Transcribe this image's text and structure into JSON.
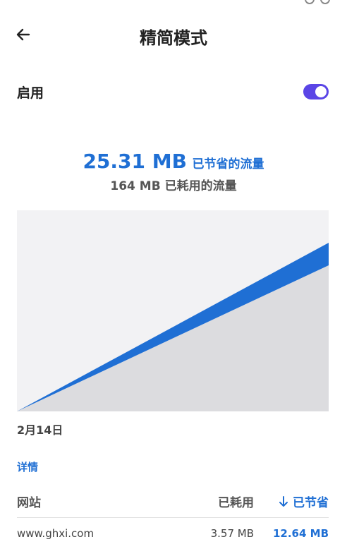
{
  "header": {
    "title": "精简模式",
    "back_icon": "arrow-left-icon"
  },
  "settings": {
    "enable_label": "启用",
    "enabled": true,
    "toggle_color": "#5a45e6"
  },
  "stats": {
    "saved_value": "25.31 MB",
    "saved_label": "已节省的流量",
    "used_text": "164 MB 已耗用的流量"
  },
  "chart_data": {
    "type": "area",
    "x": [
      "start",
      "end"
    ],
    "series": [
      {
        "values": [
          0,
          164
        ]
      },
      {
        "values": [
          0,
          25.31
        ]
      }
    ],
    "xlabel": "2月14日",
    "colors": {
      "used": "#dcdcdf",
      "saved": "#1f6fd4",
      "background": "#f2f2f4"
    }
  },
  "details": {
    "label": "详情"
  },
  "table": {
    "headers": {
      "site": "网站",
      "used": "已耗用",
      "saved": "已节省"
    },
    "sort_icon": "arrow-down-icon",
    "rows": [
      {
        "site": "www.ghxi.com",
        "used": "3.57 MB",
        "saved": "12.64 MB"
      }
    ]
  },
  "colors": {
    "accent": "#1f6fd4",
    "toggle": "#5a45e6"
  }
}
